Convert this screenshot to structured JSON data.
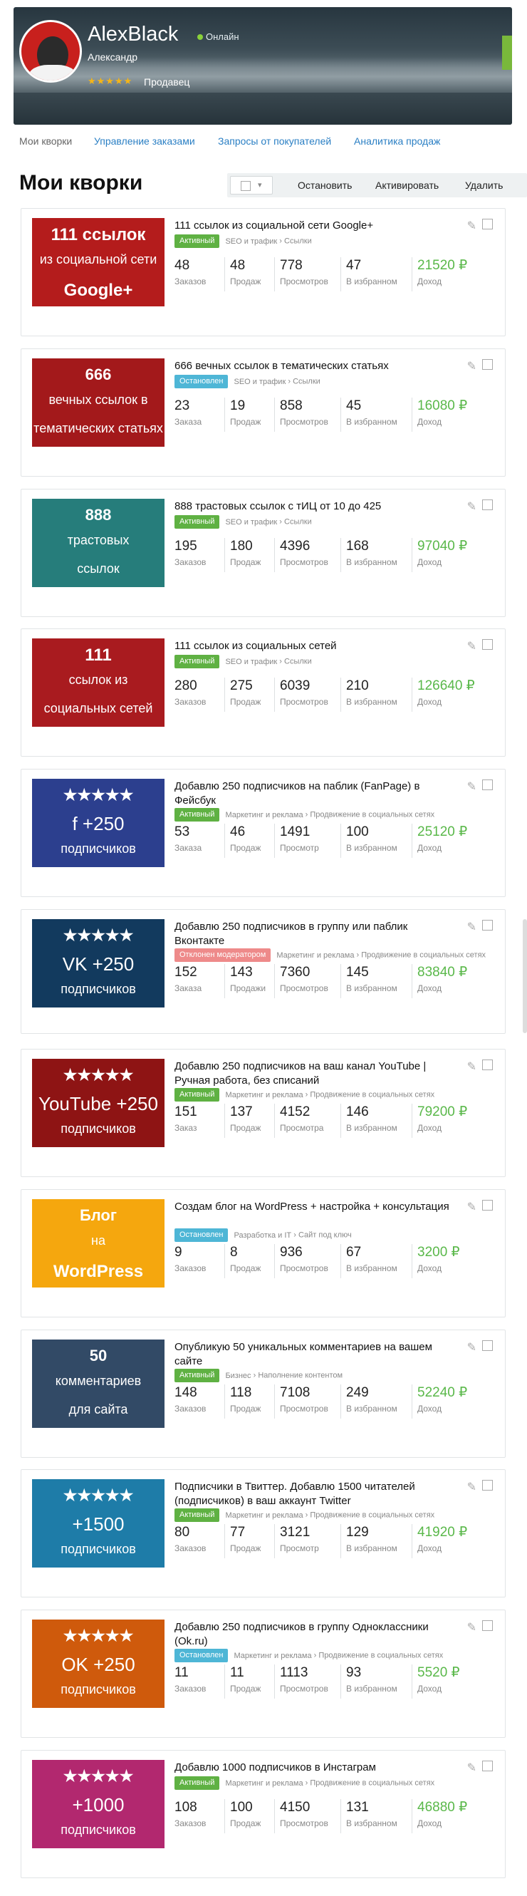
{
  "profile": {
    "username": "AlexBlack",
    "status": "Онлайн",
    "realname": "Александр",
    "stars": "★★★★★",
    "role": "Продавец"
  },
  "tabs": [
    {
      "label": "Мои кворки"
    },
    {
      "label": "Управление заказами"
    },
    {
      "label": "Запросы от покупателей"
    },
    {
      "label": "Аналитика продаж"
    }
  ],
  "page_title": "Мои кворки",
  "toolbar": {
    "stop": "Остановить",
    "activate": "Активировать",
    "delete": "Удалить"
  },
  "colors": {
    "active": "#5fb143",
    "stopped": "#4eb6d6",
    "rejected": "#ee8a8a",
    "income": "#5ab84a",
    "link": "#2a7fc4"
  },
  "kworks": [
    {
      "title": "111 ссылок из социальной сети Google+",
      "status": "Активный",
      "category": "SEO и трафик",
      "subcategory": "Ссылки",
      "thumb": {
        "lines": [
          "111 ссылок",
          "из социальной сети",
          "Google+"
        ],
        "bg": "#b41c1c"
      },
      "stats": [
        {
          "value": "48",
          "label": "Заказов"
        },
        {
          "value": "48",
          "label": "Продаж"
        },
        {
          "value": "778",
          "label": "Просмотров"
        },
        {
          "value": "47",
          "label": "В избранном"
        },
        {
          "value": "21520 ₽",
          "label": "Доход"
        }
      ]
    },
    {
      "title": "666 вечных ссылок в тематических статьях",
      "status": "Остановлен",
      "category": "SEO и трафик",
      "subcategory": "Ссылки",
      "thumb": {
        "lines": [
          "666",
          "вечных ссылок в",
          "тематических статьях"
        ],
        "bg": "#a3191b"
      },
      "stats": [
        {
          "value": "23",
          "label": "Заказа"
        },
        {
          "value": "19",
          "label": "Продаж"
        },
        {
          "value": "858",
          "label": "Просмотров"
        },
        {
          "value": "45",
          "label": "В избранном"
        },
        {
          "value": "16080 ₽",
          "label": "Доход"
        }
      ]
    },
    {
      "title": "888 трастовых ссылок с тИЦ от 10 до 425",
      "status": "Активный",
      "category": "SEO и трафик",
      "subcategory": "Ссылки",
      "thumb": {
        "lines": [
          "888",
          "трастовых",
          "ссылок"
        ],
        "bg": "#267d7b"
      },
      "stats": [
        {
          "value": "195",
          "label": "Заказов"
        },
        {
          "value": "180",
          "label": "Продаж"
        },
        {
          "value": "4396",
          "label": "Просмотров"
        },
        {
          "value": "168",
          "label": "В избранном"
        },
        {
          "value": "97040 ₽",
          "label": "Доход"
        }
      ]
    },
    {
      "title": "111 ссылок из социальных сетей",
      "status": "Активный",
      "category": "SEO и трафик",
      "subcategory": "Ссылки",
      "thumb": {
        "lines": [
          "111",
          "ссылок из",
          "социальных сетей"
        ],
        "bg": "#a91b1f"
      },
      "stats": [
        {
          "value": "280",
          "label": "Заказов"
        },
        {
          "value": "275",
          "label": "Продаж"
        },
        {
          "value": "6039",
          "label": "Просмотров"
        },
        {
          "value": "210",
          "label": "В избранном"
        },
        {
          "value": "126640 ₽",
          "label": "Доход"
        }
      ]
    },
    {
      "title": "Добавлю 250 подписчиков на паблик (FanPage) в Фейсбук",
      "status": "Активный",
      "category": "Маркетинг и реклама",
      "subcategory": "Продвижение в социальных сетях",
      "thumb": {
        "lines": [
          "★★★★★",
          "f +250",
          "подписчиков"
        ],
        "bg": "#2c3f8e"
      },
      "stats": [
        {
          "value": "53",
          "label": "Заказа"
        },
        {
          "value": "46",
          "label": "Продаж"
        },
        {
          "value": "1491",
          "label": "Просмотр"
        },
        {
          "value": "100",
          "label": "В избранном"
        },
        {
          "value": "25120 ₽",
          "label": "Доход"
        }
      ]
    },
    {
      "title": "Добавлю 250 подписчиков в группу или паблик Вконтакте",
      "status": "Отклонен модератором",
      "category": "Маркетинг и реклама",
      "subcategory": "Продвижение в социальных сетях",
      "thumb": {
        "lines": [
          "★★★★★",
          "VK +250",
          "подписчиков"
        ],
        "bg": "#123a5e"
      },
      "stats": [
        {
          "value": "152",
          "label": "Заказа"
        },
        {
          "value": "143",
          "label": "Продажи"
        },
        {
          "value": "7360",
          "label": "Просмотров"
        },
        {
          "value": "145",
          "label": "В избранном"
        },
        {
          "value": "83840 ₽",
          "label": "Доход"
        }
      ]
    },
    {
      "title": "Добавлю 250 подписчиков на ваш канал YouTube | Ручная работа, без списаний",
      "status": "Активный",
      "category": "Маркетинг и реклама",
      "subcategory": "Продвижение в социальных сетях",
      "thumb": {
        "lines": [
          "★★★★★",
          "YouTube +250",
          "подписчиков"
        ],
        "bg": "#8e1414"
      },
      "stats": [
        {
          "value": "151",
          "label": "Заказ"
        },
        {
          "value": "137",
          "label": "Продаж"
        },
        {
          "value": "4152",
          "label": "Просмотра"
        },
        {
          "value": "146",
          "label": "В избранном"
        },
        {
          "value": "79200 ₽",
          "label": "Доход"
        }
      ]
    },
    {
      "title": "Создам блог на WordPress + настройка + консультация",
      "status": "Остановлен",
      "category": "Разработка и IT",
      "subcategory": "Сайт под ключ",
      "thumb": {
        "lines": [
          "Блог",
          "на",
          "WordPress"
        ],
        "bg": "#f5a70e"
      },
      "stats": [
        {
          "value": "9",
          "label": "Заказов"
        },
        {
          "value": "8",
          "label": "Продаж"
        },
        {
          "value": "936",
          "label": "Просмотров"
        },
        {
          "value": "67",
          "label": "В избранном"
        },
        {
          "value": "3200 ₽",
          "label": "Доход"
        }
      ]
    },
    {
      "title": "Опубликую 50 уникальных комментариев на вашем сайте",
      "status": "Активный",
      "category": "Бизнес",
      "subcategory": "Наполнение контентом",
      "thumb": {
        "lines": [
          "50",
          "комментариев",
          "для сайта"
        ],
        "bg": "#324a66"
      },
      "stats": [
        {
          "value": "148",
          "label": "Заказов"
        },
        {
          "value": "118",
          "label": "Продаж"
        },
        {
          "value": "7108",
          "label": "Просмотров"
        },
        {
          "value": "249",
          "label": "В избранном"
        },
        {
          "value": "52240 ₽",
          "label": "Доход"
        }
      ]
    },
    {
      "title": "Подписчики в Твиттер. Добавлю 1500 читателей (подписчиков) в ваш аккаунт Twitter",
      "status": "Активный",
      "category": "Маркетинг и реклама",
      "subcategory": "Продвижение в социальных сетях",
      "thumb": {
        "lines": [
          "★★★★★",
          "+1500",
          "подписчиков"
        ],
        "bg": "#1e7ca8"
      },
      "stats": [
        {
          "value": "80",
          "label": "Заказов"
        },
        {
          "value": "77",
          "label": "Продаж"
        },
        {
          "value": "3121",
          "label": "Просмотр"
        },
        {
          "value": "129",
          "label": "В избранном"
        },
        {
          "value": "41920 ₽",
          "label": "Доход"
        }
      ]
    },
    {
      "title": "Добавлю 250 подписчиков в группу Одноклассники (Ok.ru)",
      "status": "Остановлен",
      "category": "Маркетинг и реклама",
      "subcategory": "Продвижение в социальных сетях",
      "thumb": {
        "lines": [
          "★★★★★",
          "OK +250",
          "подписчиков"
        ],
        "bg": "#cf5a0c"
      },
      "stats": [
        {
          "value": "11",
          "label": "Заказов"
        },
        {
          "value": "11",
          "label": "Продаж"
        },
        {
          "value": "1113",
          "label": "Просмотров"
        },
        {
          "value": "93",
          "label": "В избранном"
        },
        {
          "value": "5520 ₽",
          "label": "Доход"
        }
      ]
    },
    {
      "title": "Добавлю 1000 подписчиков в Инстаграм",
      "status": "Активный",
      "category": "Маркетинг и реклама",
      "subcategory": "Продвижение в социальных сетях",
      "thumb": {
        "lines": [
          "★★★★★",
          "+1000",
          "подписчиков"
        ],
        "bg": "#b2286f"
      },
      "stats": [
        {
          "value": "108",
          "label": "Заказов"
        },
        {
          "value": "100",
          "label": "Продаж"
        },
        {
          "value": "4150",
          "label": "Просмотров"
        },
        {
          "value": "131",
          "label": "В избранном"
        },
        {
          "value": "46880 ₽",
          "label": "Доход"
        }
      ]
    }
  ]
}
